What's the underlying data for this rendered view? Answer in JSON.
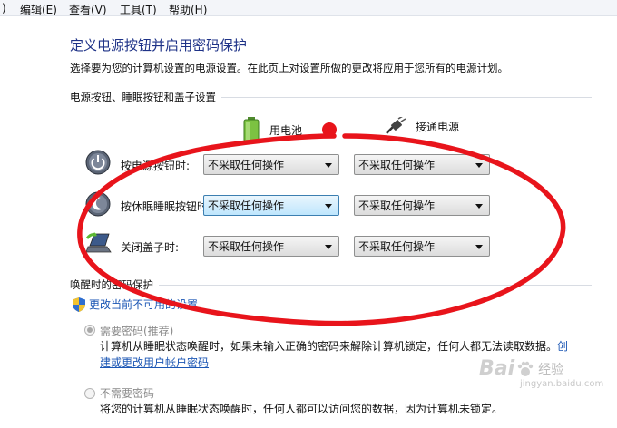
{
  "menubar": {
    "items": [
      {
        "label": ")"
      },
      {
        "label": "编辑(E)"
      },
      {
        "label": "查看(V)"
      },
      {
        "label": "工具(T)"
      },
      {
        "label": "帮助(H)"
      }
    ]
  },
  "page": {
    "title": "定义电源按钮并启用密码保护",
    "subtitle": "选择要为您的计算机设置的电源设置。在此页上对设置所做的更改将应用于您所有的电源计划。"
  },
  "power_buttons": {
    "section_label": "电源按钮、睡眠按钮和盖子设置",
    "col_battery": "用电池",
    "col_plugged": "接通电源",
    "rows": [
      {
        "label": "按电源按钮时:",
        "battery": "不采取任何操作",
        "plugged": "不采取任何操作",
        "icon": "power-button-icon"
      },
      {
        "label": "按休眠睡眠按钮时:",
        "battery": "不采取任何操作",
        "plugged": "不采取任何操作",
        "icon": "sleep-button-icon"
      },
      {
        "label": "关闭盖子时:",
        "battery": "不采取任何操作",
        "plugged": "不采取任何操作",
        "icon": "laptop-lid-icon"
      }
    ]
  },
  "wake_password": {
    "section_label": "唤醒时的密码保护",
    "change_link": "更改当前不可用的设置",
    "option_require": {
      "label": "需要密码(推荐)",
      "description": "计算机从睡眠状态唤醒时，如果未输入正确的密码来解除计算机锁定，任何人都无法读取数据。",
      "link_start": "创",
      "link_rest": "建或更改用户帐户密码",
      "selected": true
    },
    "option_none": {
      "label": "不需要密码",
      "description": "将您的计算机从睡眠状态唤醒时，任何人都可以访问您的数据，因为计算机未锁定。",
      "selected": false
    }
  },
  "watermark": {
    "bai": "Bai",
    "text": "经验",
    "sub": "jingyan.baidu.com"
  },
  "colors": {
    "title": "#1e3287",
    "link": "#1b56b4",
    "annotation": "#e8141b",
    "focused_select": "#bee6fd"
  }
}
